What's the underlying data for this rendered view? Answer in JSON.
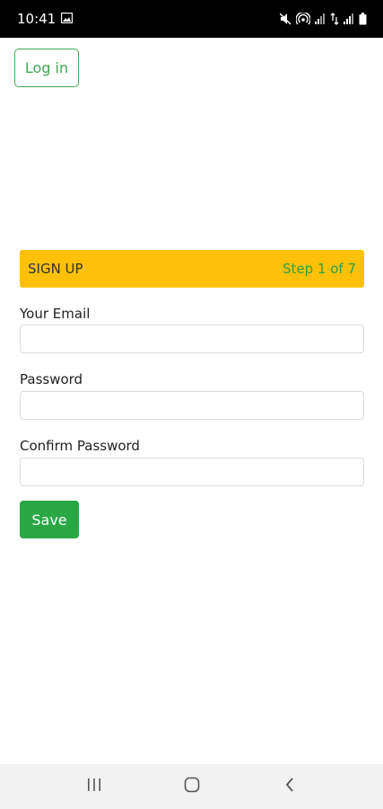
{
  "status_bar": {
    "time": "10:41",
    "icons": [
      "gallery-icon",
      "mute-icon",
      "hotspot-icon",
      "signal-icon",
      "data-icon",
      "signal-icon",
      "battery-icon"
    ]
  },
  "header": {
    "login_label": "Log in"
  },
  "signup": {
    "title": "SIGN UP",
    "step": "Step 1 of 7",
    "accent_color": "#fec107",
    "step_color": "#2e9d48"
  },
  "form": {
    "email_label": "Your Email",
    "email_value": "",
    "password_label": "Password",
    "password_value": "",
    "confirm_label": "Confirm Password",
    "confirm_value": "",
    "save_label": "Save",
    "save_color": "#29a745"
  },
  "nav_bar": {
    "buttons": [
      "recents-icon",
      "home-icon",
      "back-icon"
    ]
  }
}
